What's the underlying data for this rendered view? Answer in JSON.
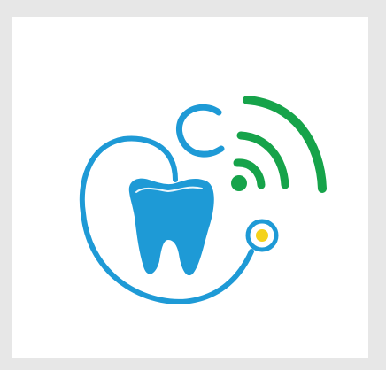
{
  "logo": {
    "icon": "tele-dentistry-tooth-stethoscope-wifi-icon",
    "colors": {
      "background": "#e7e7e7",
      "card": "#ffffff",
      "tooth": "#1e9ad6",
      "stethoscope": "#1e9ad6",
      "wifi": "#16a34a",
      "chestpiece_center": "#f4d21a"
    }
  }
}
